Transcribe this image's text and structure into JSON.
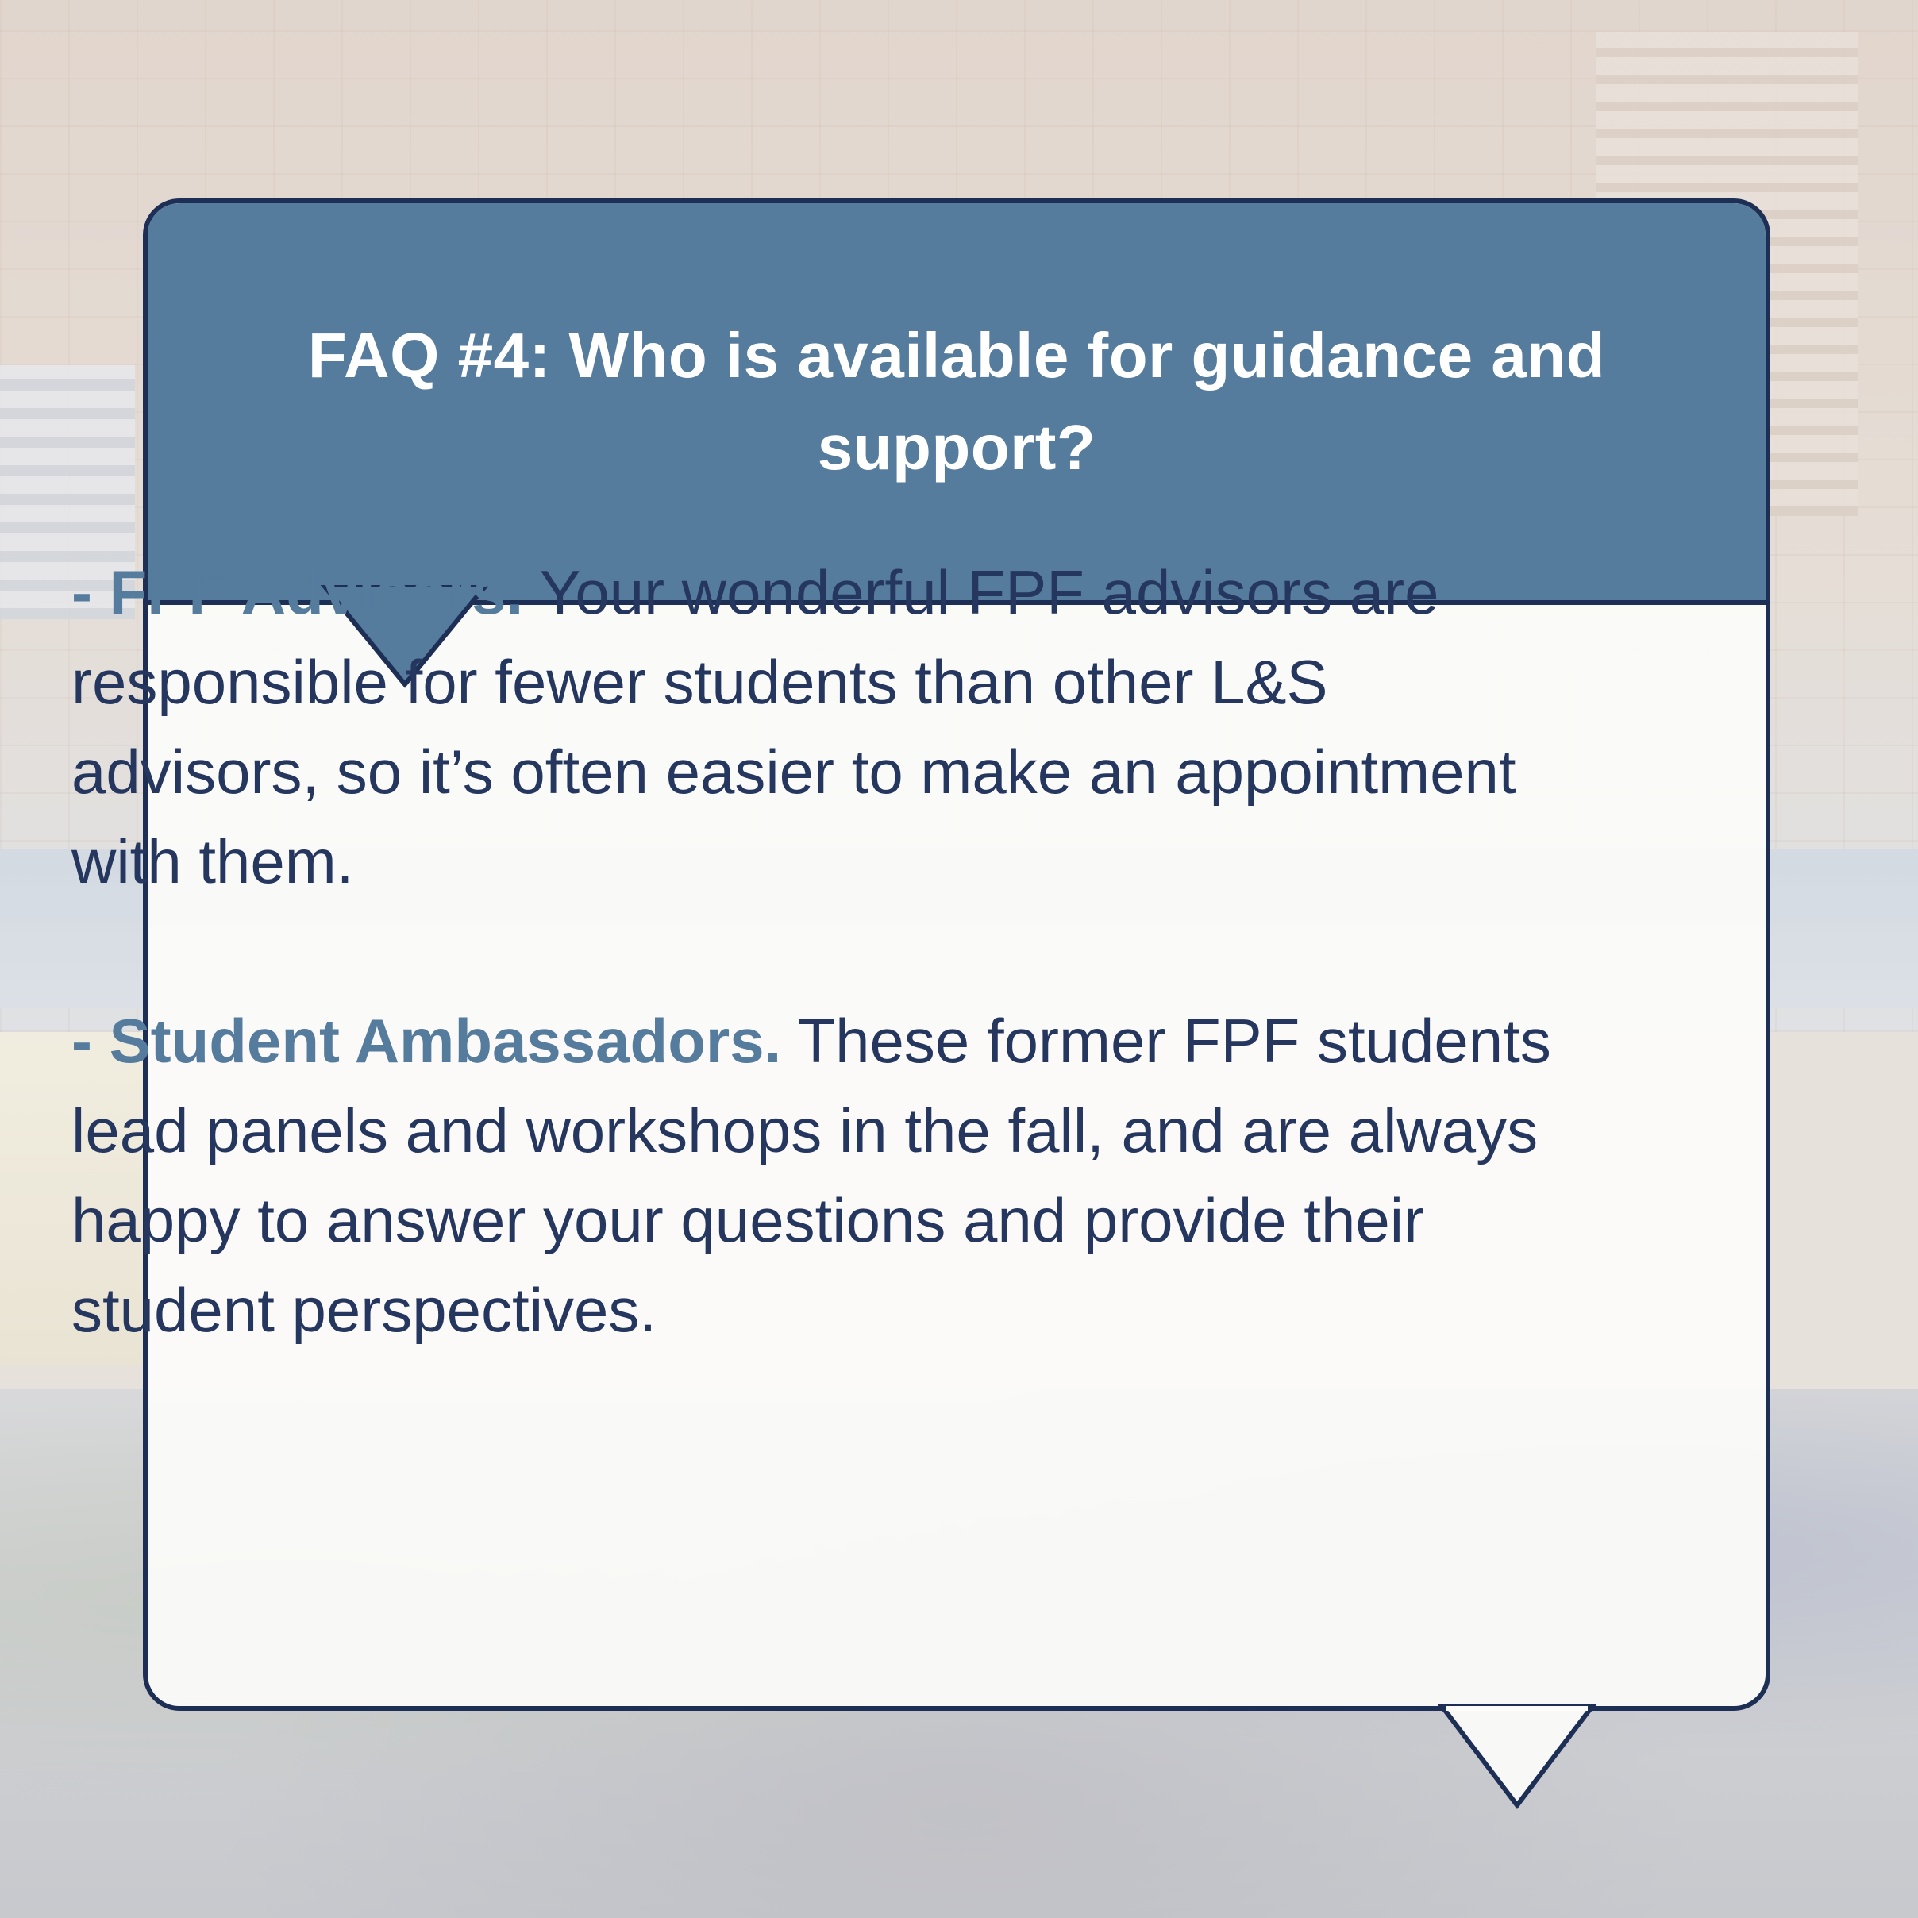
{
  "header": {
    "title": "FAQ #4: Who is available for guidance and support?"
  },
  "items": [
    {
      "lead": "- FPF Advisors.",
      "text": " Your wonderful FPF advisors are responsible for fewer students than other L&S advisors, so it’s often easier to make an appointment with them."
    },
    {
      "lead": "- Student Ambassadors.",
      "text": " These former FPF students lead panels and workshops in the fall, and are always happy to answer your questions and provide their student perspectives."
    }
  ],
  "colors": {
    "header_background": "#557b9d",
    "border": "#1e2f55",
    "body_text": "#25365f",
    "lead_text": "#557b9d",
    "card_background": "#fcfcfa"
  },
  "icons": {
    "header_pointer": "speech-pointer-icon",
    "bottom_pointer": "speech-tail-icon"
  }
}
